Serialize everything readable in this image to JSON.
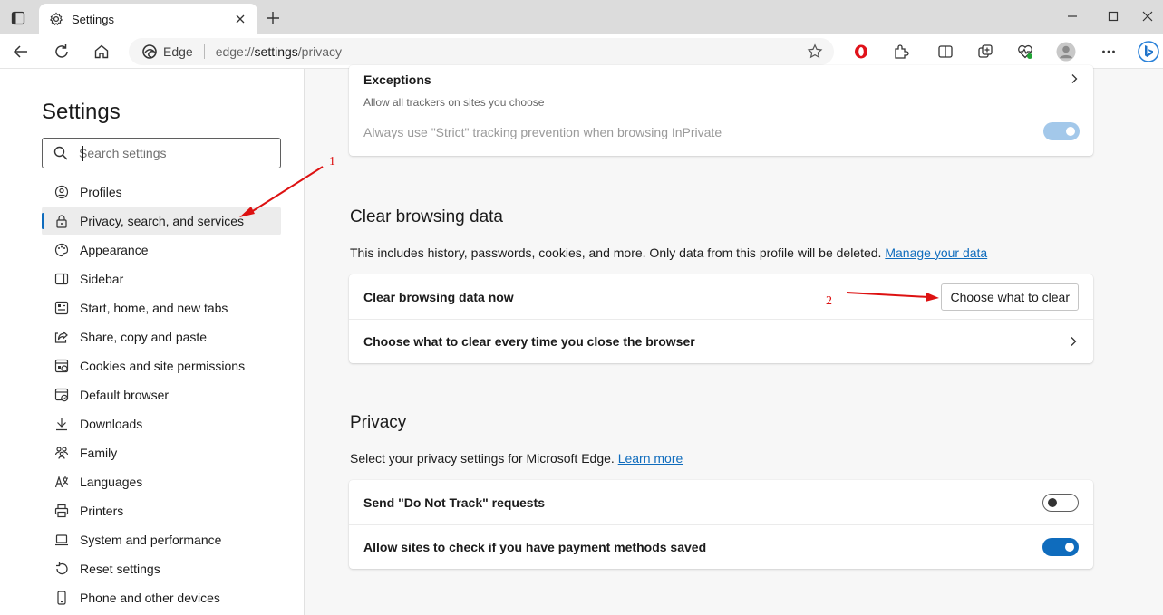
{
  "browser": {
    "tab_title": "Settings",
    "omnibox_site": "Edge",
    "url_scheme": "edge://",
    "url_host": "settings",
    "url_path": "/privacy"
  },
  "sidebar": {
    "title": "Settings",
    "search_placeholder": "Search settings",
    "items": [
      {
        "label": "Profiles",
        "icon": "profile-icon"
      },
      {
        "label": "Privacy, search, and services",
        "icon": "lock-icon",
        "active": true
      },
      {
        "label": "Appearance",
        "icon": "palette-icon"
      },
      {
        "label": "Sidebar",
        "icon": "sidebar-icon"
      },
      {
        "label": "Start, home, and new tabs",
        "icon": "home-tabs-icon"
      },
      {
        "label": "Share, copy and paste",
        "icon": "share-icon"
      },
      {
        "label": "Cookies and site permissions",
        "icon": "cookies-icon"
      },
      {
        "label": "Default browser",
        "icon": "browser-icon"
      },
      {
        "label": "Downloads",
        "icon": "download-icon"
      },
      {
        "label": "Family",
        "icon": "family-icon"
      },
      {
        "label": "Languages",
        "icon": "languages-icon"
      },
      {
        "label": "Printers",
        "icon": "printer-icon"
      },
      {
        "label": "System and performance",
        "icon": "laptop-icon"
      },
      {
        "label": "Reset settings",
        "icon": "reset-icon"
      },
      {
        "label": "Phone and other devices",
        "icon": "phone-icon"
      }
    ]
  },
  "tracking": {
    "exceptions_title": "Exceptions",
    "exceptions_desc": "Allow all trackers on sites you choose",
    "strict_label": "Always use \"Strict\" tracking prevention when browsing InPrivate",
    "strict_on": true
  },
  "clear_data": {
    "title": "Clear browsing data",
    "desc": "This includes history, passwords, cookies, and more. Only data from this profile will be deleted.",
    "manage_link": "Manage your data",
    "now_label": "Clear browsing data now",
    "choose_button": "Choose what to clear",
    "every_time_label": "Choose what to clear every time you close the browser"
  },
  "privacy": {
    "title": "Privacy",
    "desc": "Select your privacy settings for Microsoft Edge.",
    "learn_link": "Learn more",
    "dnt_label": "Send \"Do Not Track\" requests",
    "dnt_on": false,
    "payment_label": "Allow sites to check if you have payment methods saved",
    "payment_on": true
  },
  "annotations": {
    "marker_1": "1",
    "marker_2": "2"
  },
  "colors": {
    "accent": "#0f6cbd",
    "annotation": "#dd1111"
  }
}
